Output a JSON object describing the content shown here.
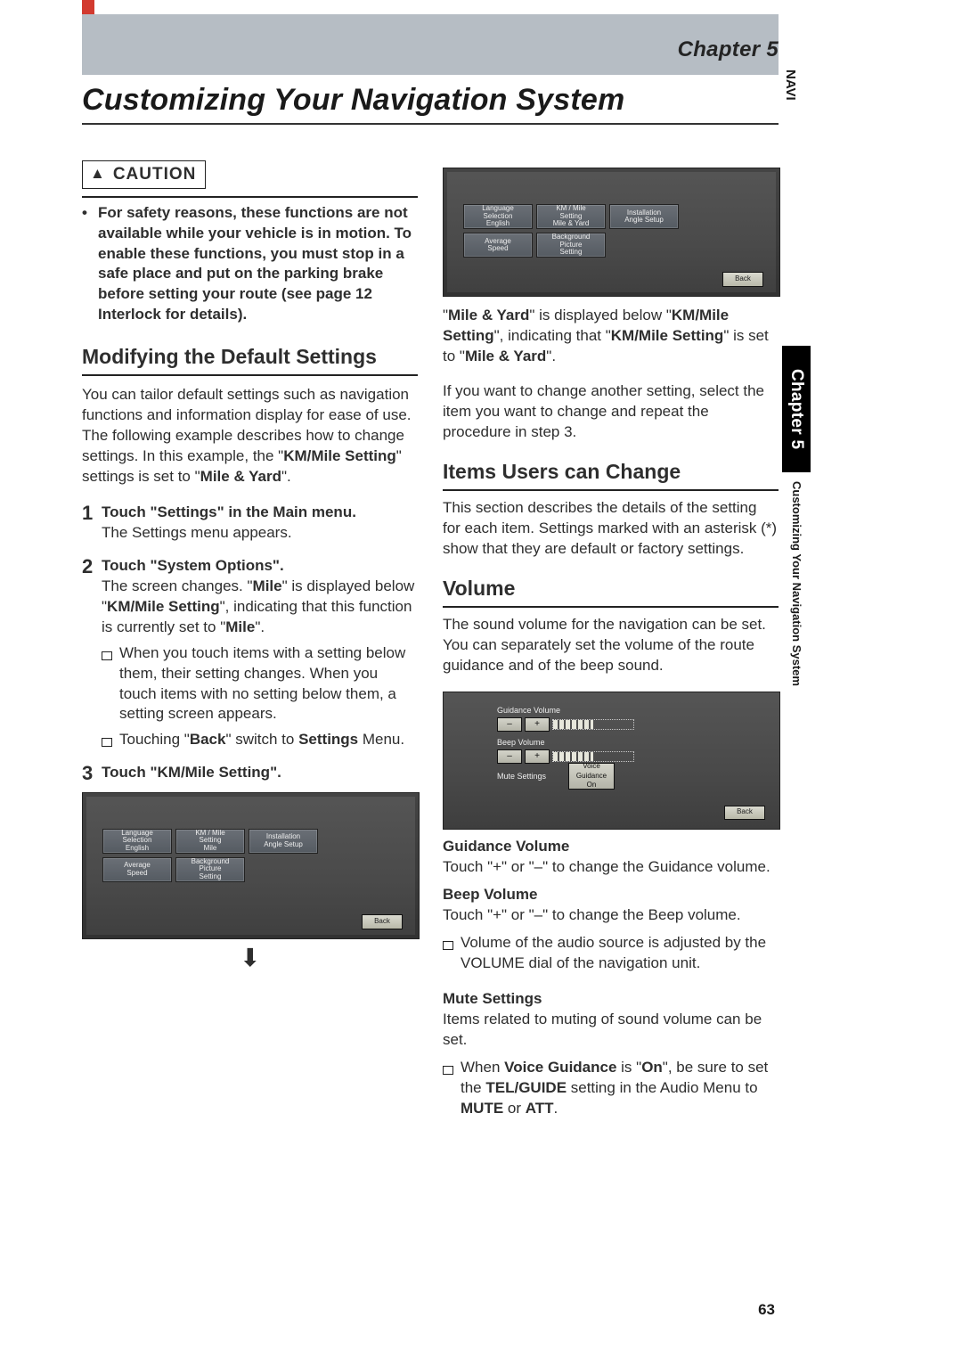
{
  "chapter_label": "Chapter 5",
  "page_title": "Customizing Your Navigation System",
  "tab_navi": "NAVI",
  "side_tab_label": "Chapter 5",
  "side_subtitle": "Customizing Your Navigation System",
  "page_number": "63",
  "caution": {
    "heading": "CAUTION",
    "body_pre": "For safety reasons, these functions are not available while your vehicle is in motion. To enable these functions, you must stop in a safe place and put on the parking brake before setting your route (see page 12 Interlock for details)."
  },
  "left": {
    "h_modify": "Modifying the Default Settings",
    "intro_1": "You can tailor default settings such as navigation functions and information display for ease of use. The following example describes how to change settings. In this example, the \"",
    "intro_k1": "KM/Mile Setting",
    "intro_2": "\" settings is set to \"",
    "intro_k2": "Mile & Yard",
    "intro_3": "\".",
    "step1_lead": "Touch \"Settings\" in the Main menu.",
    "step1_body": "The Settings menu appears.",
    "step2_lead": "Touch \"System Options\".",
    "step2_body_a": "The screen changes. \"",
    "step2_body_k1": "Mile",
    "step2_body_b": "\" is displayed below \"",
    "step2_body_k2": "KM/Mile Setting",
    "step2_body_c": "\", indicating that this function is currently set to \"",
    "step2_body_k3": "Mile",
    "step2_body_d": "\".",
    "step2_note1": "When you touch items with a setting below them, their setting changes. When you touch items with no setting below them, a setting screen appears.",
    "step2_note2_a": "Touching \"",
    "step2_note2_k1": "Back",
    "step2_note2_b": "\" switch to ",
    "step2_note2_k2": "Settings",
    "step2_note2_c": " Menu.",
    "step3_lead": "Touch \"KM/Mile Setting\"."
  },
  "nav_buttons": {
    "a1a": "Language",
    "a1b": "Selection",
    "a1c": "English",
    "a2a": "KM / Mile",
    "a2b": "Setting",
    "a2c": "Mile",
    "a3a": "Installation",
    "a3b": "Angle Setup",
    "b1a": "Average",
    "b1b": "Speed",
    "b2a": "Background",
    "b2b": "Picture",
    "b2c": "Setting",
    "back": "Back",
    "a2c_alt": "Mile & Yard"
  },
  "right": {
    "para1_a": "\"",
    "para1_k1": "Mile & Yard",
    "para1_b": "\" is displayed below \"",
    "para1_k2": "KM/Mile Setting",
    "para1_c": "\", indicating that \"",
    "para1_k3": "KM/Mile Setting",
    "para1_d": "\" is set to \"",
    "para1_k4": "Mile & Yard",
    "para1_e": "\".",
    "para2": "If you want to change another setting, select the item you want to change and repeat the procedure in step 3.",
    "h_items": "Items Users can Change",
    "items_body": "This section describes the details of the setting for each item. Settings marked with an asterisk (*) show that they are default or factory settings.",
    "h_volume": "Volume",
    "vol_intro": "The sound volume for the navigation can be set. You can separately set the volume of the route guidance and of the beep sound.",
    "gv_head": "Guidance Volume",
    "gv_body": "Touch \"+\" or \"–\" to change the Guidance volume.",
    "bv_head": "Beep Volume",
    "bv_body": "Touch \"+\" or \"–\" to change the Beep volume.",
    "vol_note1": "Volume of the audio source is adjusted by the VOLUME dial of the navigation unit.",
    "mute_head": "Mute Settings",
    "mute_body": "Items related to muting of sound volume can be set.",
    "mute_note_a": "When ",
    "mute_note_k1": "Voice Guidance",
    "mute_note_b": " is \"",
    "mute_note_k2": "On",
    "mute_note_c": "\", be sure to set the ",
    "mute_note_k3": "TEL/GUIDE",
    "mute_note_d": " setting in the Audio Menu to ",
    "mute_note_k4": "MUTE",
    "mute_note_e": " or ",
    "mute_note_k5": "ATT",
    "mute_note_f": "."
  },
  "vol_labels": {
    "gv": "Guidance Volume",
    "bv": "Beep Volume",
    "ms": "Mute Settings",
    "voice": "Voice",
    "guid": "Guidance",
    "on": "On",
    "minus": "–",
    "plus": "+",
    "back": "Back"
  }
}
